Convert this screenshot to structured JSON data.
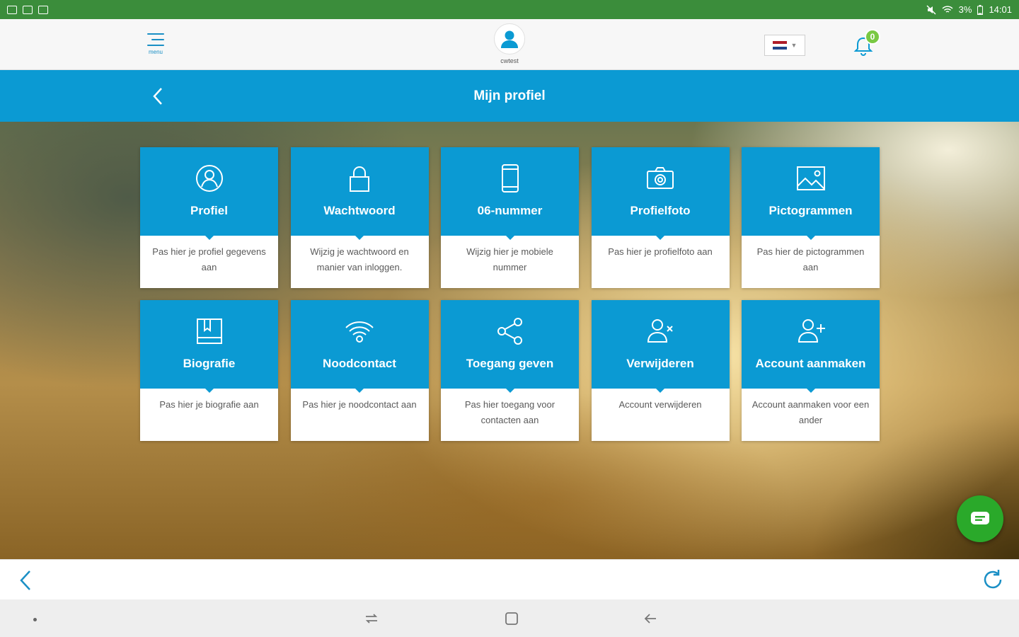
{
  "status_bar": {
    "time": "14:01",
    "battery": "3%"
  },
  "header": {
    "menu_label": "menu",
    "user_name": "cwtest",
    "notification_count": "0",
    "language_flag_colors": [
      "#ae1c28",
      "#ffffff",
      "#21468b"
    ]
  },
  "titlebar": {
    "title": "Mijn profiel"
  },
  "tiles": [
    {
      "title": "Profiel",
      "description": "Pas hier je profiel gegevens aan",
      "icon": "profile-icon"
    },
    {
      "title": "Wachtwoord",
      "description": "Wijzig je wachtwoord en manier van inloggen.",
      "icon": "lock-icon"
    },
    {
      "title": "06-nummer",
      "description": "Wijzig hier je mobiele nummer",
      "icon": "phone-icon"
    },
    {
      "title": "Profielfoto",
      "description": "Pas hier je profielfoto aan",
      "icon": "camera-icon"
    },
    {
      "title": "Pictogrammen",
      "description": "Pas hier de pictogrammen aan",
      "icon": "image-icon"
    },
    {
      "title": "Biografie",
      "description": "Pas hier je biografie aan",
      "icon": "book-icon"
    },
    {
      "title": "Noodcontact",
      "description": "Pas hier je noodcontact aan",
      "icon": "wifi-icon"
    },
    {
      "title": "Toegang geven",
      "description": "Pas hier toegang voor contacten aan",
      "icon": "share-icon"
    },
    {
      "title": "Verwijderen",
      "description": "Account verwijderen",
      "icon": "user-remove-icon"
    },
    {
      "title": "Account aanmaken",
      "description": "Account aanmaken voor een ander",
      "icon": "user-add-icon"
    }
  ],
  "colors": {
    "primary": "#0b9ad3",
    "status_bar": "#3b8d3b",
    "chat_fab": "#2aa92a",
    "badge": "#7ac943"
  }
}
